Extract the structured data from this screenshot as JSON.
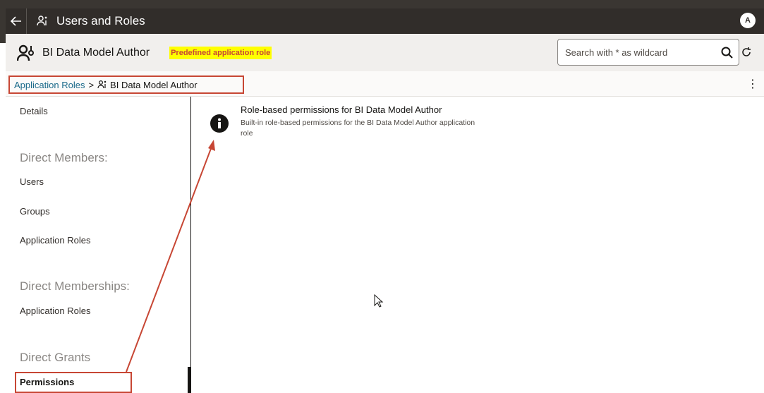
{
  "window": {
    "title": "Users and Roles",
    "avatar_initial": "A",
    "back_icon": "back-arrow-icon"
  },
  "header": {
    "role_name": "BI Data Model Author",
    "badge": "Predefined application role",
    "badge_color": "#ffff00",
    "search": {
      "placeholder": "Search with * as wildcard",
      "value": ""
    }
  },
  "breadcrumb": {
    "parent": "Application Roles",
    "separator": ">",
    "current": "BI Data Model Author"
  },
  "sidebar": {
    "details": "Details",
    "direct_members_heading": "Direct Members:",
    "users": "Users",
    "groups": "Groups",
    "members_app_roles": "Application Roles",
    "direct_memberships_heading": "Direct Memberships:",
    "memberships_app_roles": "Application Roles",
    "direct_grants_heading": "Direct Grants",
    "permissions": "Permissions"
  },
  "content": {
    "title": "Role-based permissions for BI Data Model Author",
    "description": "Built-in role-based permissions for the BI Data Model Author application role"
  },
  "colors": {
    "accent_red": "#c74634",
    "link_blue": "#1b6a8a",
    "titlebar": "#312d2a"
  }
}
